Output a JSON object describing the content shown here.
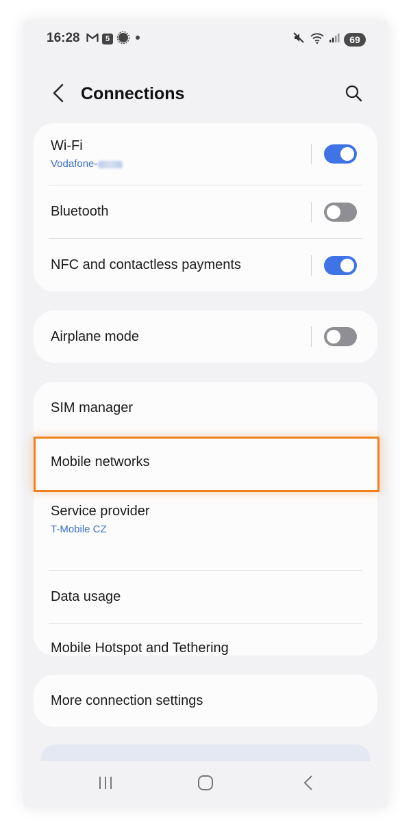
{
  "status_bar": {
    "time": "16:28",
    "left_icons": [
      "gmail-icon",
      "calendar-badge-icon",
      "signal-app-icon",
      "dot-icon"
    ],
    "calendar_day": "5",
    "right_icons": [
      "mute-icon",
      "wifi-icon",
      "cellular-icon"
    ],
    "battery": "69"
  },
  "header": {
    "title": "Connections",
    "back_icon": "chevron-left-icon",
    "search_icon": "search-icon"
  },
  "groups": {
    "group1": [
      {
        "title": "Wi-Fi",
        "subtitle": "Vodafone-",
        "toggle": true
      },
      {
        "title": "Bluetooth",
        "toggle": false
      },
      {
        "title": "NFC and contactless payments",
        "toggle": true
      }
    ],
    "group2": [
      {
        "title": "Airplane mode",
        "toggle": false
      }
    ],
    "group3": [
      {
        "title": "SIM manager"
      },
      {
        "title": "Mobile networks",
        "highlighted": true
      },
      {
        "title": "Service provider",
        "subtitle": "T-Mobile CZ"
      },
      {
        "title": "Data usage"
      },
      {
        "title": "Mobile Hotspot and Tethering"
      }
    ],
    "group4": [
      {
        "title": "More connection settings"
      }
    ]
  },
  "colors": {
    "accent": "#3f73e6",
    "subtitle": "#3b6fc9",
    "highlight": "#f07f1e",
    "background": "#f2f2f4",
    "card": "#fcfcfd"
  },
  "nav_bar": {
    "icons": [
      "recents-icon",
      "home-icon",
      "back-icon"
    ]
  }
}
